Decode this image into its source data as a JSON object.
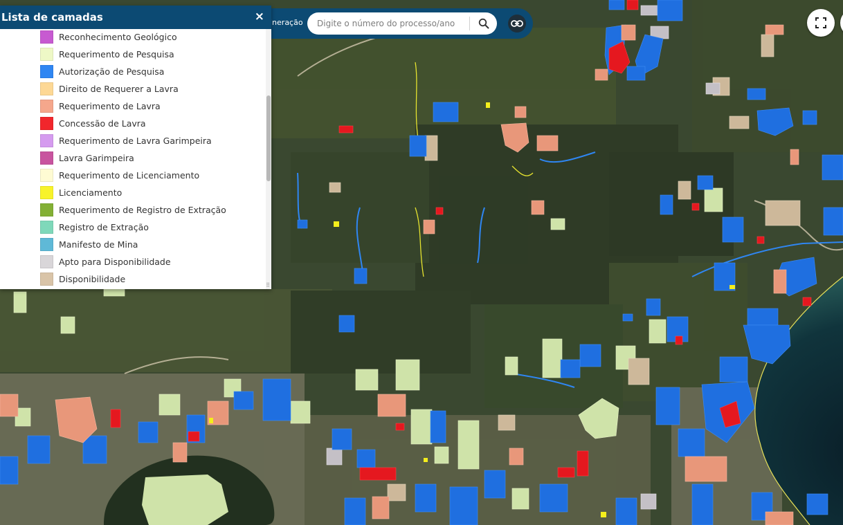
{
  "panel": {
    "title": "Lista de camadas",
    "close_label": "×",
    "layers": [
      {
        "label": "Reconhecimento Geológico",
        "color": "#c75ad1"
      },
      {
        "label": "Requerimento de Pesquisa",
        "color": "#eef8c6"
      },
      {
        "label": "Autorização de Pesquisa",
        "color": "#2f86f2"
      },
      {
        "label": "Direito de Requerer a Lavra",
        "color": "#fdd895"
      },
      {
        "label": "Requerimento de Lavra",
        "color": "#f5a78c"
      },
      {
        "label": "Concessão de Lavra",
        "color": "#f1262c"
      },
      {
        "label": "Requerimento de Lavra Garimpeira",
        "color": "#d59bef"
      },
      {
        "label": "Lavra Garimpeira",
        "color": "#c8549f"
      },
      {
        "label": "Requerimento de Licenciamento",
        "color": "#fefbd3"
      },
      {
        "label": "Licenciamento",
        "color": "#f8f32a"
      },
      {
        "label": "Requerimento de Registro de Extração",
        "color": "#83b035"
      },
      {
        "label": "Registro de Extração",
        "color": "#7fd8ba"
      },
      {
        "label": "Manifesto de Mina",
        "color": "#5fb9d7"
      },
      {
        "label": "Apto para Disponibilidade",
        "color": "#d9d6d9"
      },
      {
        "label": "Disponibilidade",
        "color": "#d9c4a8"
      }
    ]
  },
  "search": {
    "label": "ineração",
    "placeholder": "Digite o número do processo/ano",
    "value": ""
  },
  "icons": {
    "search": "search-icon",
    "link": "link-icon",
    "fullscreen": "fullscreen-icon"
  },
  "colors": {
    "header": "#0c4a73",
    "research_authorization": "#2f86f2",
    "research_request": "#d6ebb0",
    "mining_request": "#f0a482",
    "mining_concession": "#ee1d25",
    "availability": "#d9c4a8",
    "apt_availability": "#c9c5cc",
    "licensing": "#f4ee1c",
    "land_dark": "#34402a",
    "sea": "#0c2a33"
  }
}
